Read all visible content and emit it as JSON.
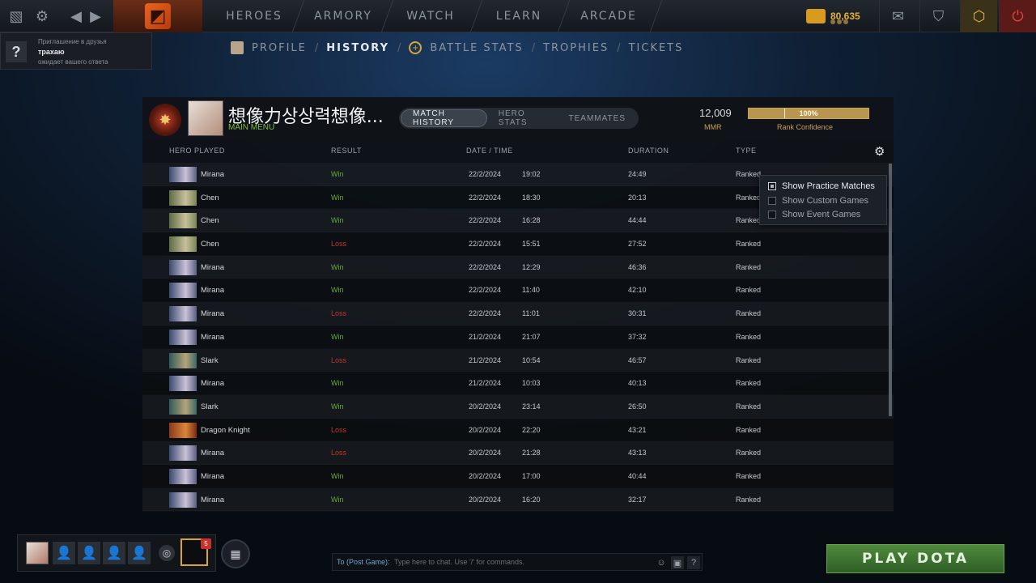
{
  "topbar": {
    "nav": [
      "HEROES",
      "ARMORY",
      "WATCH",
      "LEARN",
      "ARCADE"
    ],
    "currency": "80,635"
  },
  "subnav": {
    "items": [
      "PROFILE",
      "HISTORY",
      "BATTLE STATS",
      "TROPHIES",
      "TICKETS"
    ],
    "active": "HISTORY"
  },
  "friend_invite": {
    "title": "Приглашение в друзья",
    "name": "трахаю",
    "status": "ожидает вашего ответа"
  },
  "profile": {
    "name": "想像力상상력想像...",
    "status": "MAIN MENU",
    "tabs": [
      "MATCH HISTORY",
      "HERO STATS",
      "TEAMMATES"
    ],
    "mmr": "12,009",
    "mmr_label": "MMR",
    "confidence": "100%",
    "confidence_fraction": 1.0,
    "confidence_label": "Rank Confidence"
  },
  "columns": [
    "HERO PLAYED",
    "RESULT",
    "DATE / TIME",
    "DURATION",
    "TYPE"
  ],
  "matches": [
    {
      "hero": "Mirana",
      "result": "Win",
      "date": "22/2/2024",
      "time": "19:02",
      "duration": "24:49",
      "type": "Ranked"
    },
    {
      "hero": "Chen",
      "result": "Win",
      "date": "22/2/2024",
      "time": "18:30",
      "duration": "20:13",
      "type": "Ranked"
    },
    {
      "hero": "Chen",
      "result": "Win",
      "date": "22/2/2024",
      "time": "16:28",
      "duration": "44:44",
      "type": "Ranked"
    },
    {
      "hero": "Chen",
      "result": "Loss",
      "date": "22/2/2024",
      "time": "15:51",
      "duration": "27:52",
      "type": "Ranked"
    },
    {
      "hero": "Mirana",
      "result": "Win",
      "date": "22/2/2024",
      "time": "12:29",
      "duration": "46:36",
      "type": "Ranked"
    },
    {
      "hero": "Mirana",
      "result": "Win",
      "date": "22/2/2024",
      "time": "11:40",
      "duration": "42:10",
      "type": "Ranked"
    },
    {
      "hero": "Mirana",
      "result": "Loss",
      "date": "22/2/2024",
      "time": "11:01",
      "duration": "30:31",
      "type": "Ranked"
    },
    {
      "hero": "Mirana",
      "result": "Win",
      "date": "21/2/2024",
      "time": "21:07",
      "duration": "37:32",
      "type": "Ranked"
    },
    {
      "hero": "Slark",
      "result": "Loss",
      "date": "21/2/2024",
      "time": "10:54",
      "duration": "46:57",
      "type": "Ranked"
    },
    {
      "hero": "Mirana",
      "result": "Win",
      "date": "21/2/2024",
      "time": "10:03",
      "duration": "40:13",
      "type": "Ranked"
    },
    {
      "hero": "Slark",
      "result": "Win",
      "date": "20/2/2024",
      "time": "23:14",
      "duration": "26:50",
      "type": "Ranked"
    },
    {
      "hero": "Dragon Knight",
      "result": "Loss",
      "date": "20/2/2024",
      "time": "22:20",
      "duration": "43:21",
      "type": "Ranked"
    },
    {
      "hero": "Mirana",
      "result": "Loss",
      "date": "20/2/2024",
      "time": "21:28",
      "duration": "43:13",
      "type": "Ranked"
    },
    {
      "hero": "Mirana",
      "result": "Win",
      "date": "20/2/2024",
      "time": "17:00",
      "duration": "40:44",
      "type": "Ranked"
    },
    {
      "hero": "Mirana",
      "result": "Win",
      "date": "20/2/2024",
      "time": "16:20",
      "duration": "32:17",
      "type": "Ranked"
    }
  ],
  "filter_menu": {
    "items": [
      "Show Practice Matches",
      "Show Custom Games",
      "Show Event Games"
    ]
  },
  "party": {
    "badge": "5"
  },
  "chat": {
    "target": "To (Post Game):",
    "placeholder": "Type here to chat. Use '/' for commands.",
    "help": "?"
  },
  "play_button": "PLAY DOTA",
  "colors": {
    "win": "#6aa93b",
    "loss": "#c2342c",
    "accent_gold": "#e3b03c",
    "play_green": "#4f8a3d"
  },
  "icons": {
    "Mirana": "mirana-portrait",
    "Chen": "chen-portrait",
    "Slark": "slark-portrait",
    "Dragon Knight": "dragon-knight-portrait"
  }
}
